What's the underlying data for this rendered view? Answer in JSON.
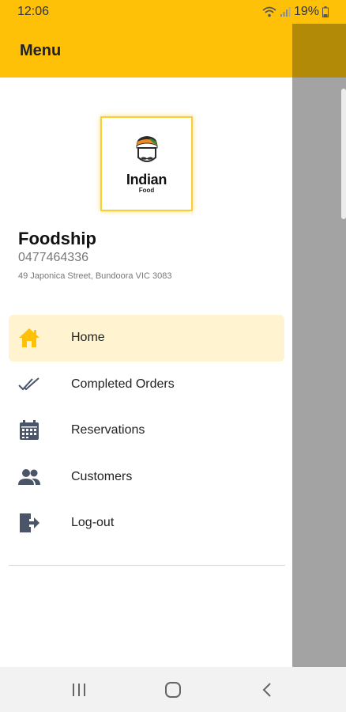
{
  "status_bar": {
    "time": "12:06",
    "battery": "19%",
    "icons": [
      "wifi-icon",
      "signal-icon",
      "battery-icon"
    ]
  },
  "app_bar": {
    "title": "Menu"
  },
  "logo": {
    "title": "Indian",
    "subtitle": "Food"
  },
  "profile": {
    "name": "Foodship",
    "phone": "0477464336",
    "address": "49 Japonica Street, Bundoora VIC 3083"
  },
  "menu": [
    {
      "label": "Home",
      "icon": "home-icon",
      "active": true
    },
    {
      "label": "Completed Orders",
      "icon": "double-check-icon",
      "active": false
    },
    {
      "label": "Reservations",
      "icon": "calendar-icon",
      "active": false
    },
    {
      "label": "Customers",
      "icon": "people-icon",
      "active": false
    },
    {
      "label": "Log-out",
      "icon": "logout-icon",
      "active": false
    }
  ],
  "navigation": [
    "recent-apps-button",
    "home-button",
    "back-button"
  ],
  "colors": {
    "accent": "#FFC107",
    "active_item_bg": "#FFF4CF",
    "icon_gray": "#4A5568"
  }
}
